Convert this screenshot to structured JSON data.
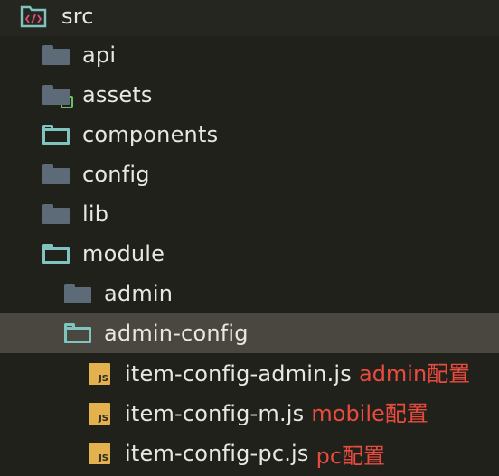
{
  "colors": {
    "background": "#21211c",
    "selected_row": "#4a4740",
    "text": "#e8e8e0",
    "annotation": "#ea4b3f",
    "closed_folder": "#5d6b78",
    "open_folder": "#7fc4be",
    "js_icon": "#e3b24e"
  },
  "tree": {
    "root": {
      "label": "src",
      "icon": "source-folder-icon"
    },
    "items": [
      {
        "label": "api",
        "icon": "folder-icon",
        "state": "closed"
      },
      {
        "label": "assets",
        "icon": "assets-folder-icon",
        "state": "closed"
      },
      {
        "label": "components",
        "icon": "folder-open-icon",
        "state": "open"
      },
      {
        "label": "config",
        "icon": "folder-icon",
        "state": "closed"
      },
      {
        "label": "lib",
        "icon": "folder-icon",
        "state": "closed"
      },
      {
        "label": "module",
        "icon": "folder-open-icon",
        "state": "open"
      },
      {
        "label": "admin",
        "icon": "folder-icon",
        "state": "closed"
      },
      {
        "label": "admin-config",
        "icon": "folder-open-icon",
        "state": "open",
        "selected": true
      },
      {
        "label": "item-config-admin.js",
        "icon": "js-file-icon",
        "icon_text": "JS",
        "note": "admin配置"
      },
      {
        "label": "item-config-m.js",
        "icon": "js-file-icon",
        "icon_text": "JS",
        "note": "mobile配置"
      },
      {
        "label": "item-config-pc.js",
        "icon": "js-file-icon",
        "icon_text": "JS",
        "note": "pc配置"
      }
    ]
  }
}
